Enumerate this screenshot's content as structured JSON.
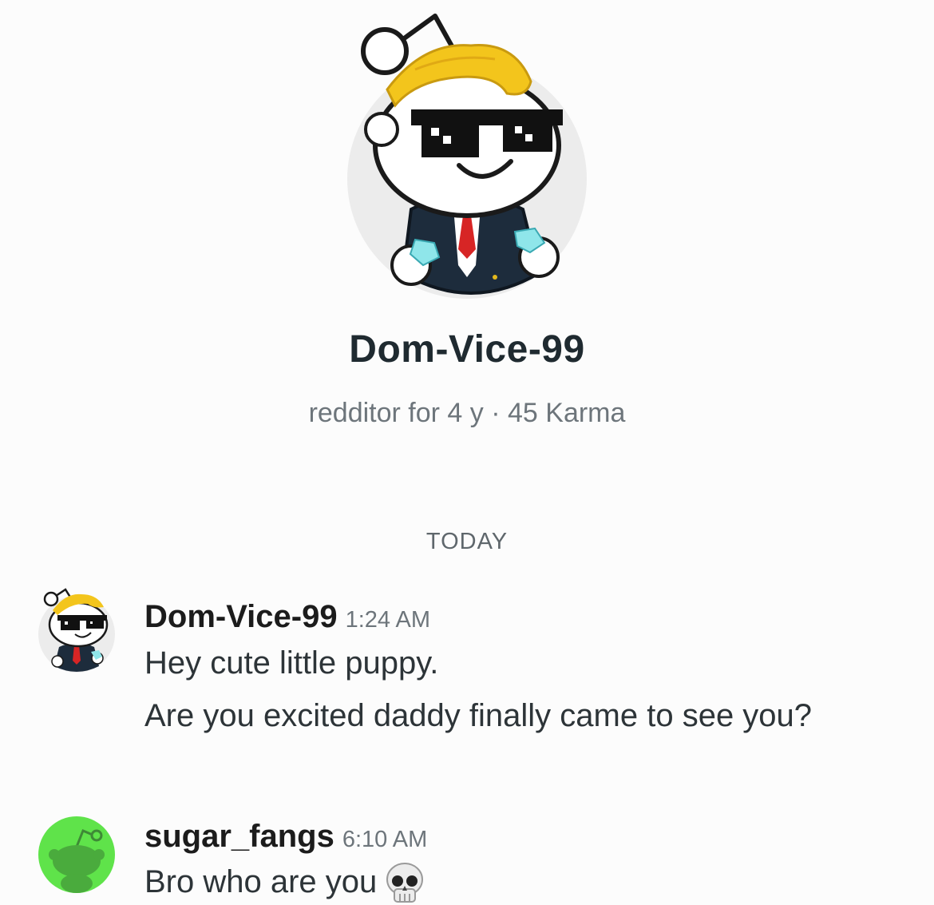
{
  "profile": {
    "username": "Dom-Vice-99",
    "meta": "redditor for 4 y · 45 Karma",
    "avatar_icon": "snoo-avatar-sunglasses-suit"
  },
  "divider": {
    "label": "TODAY"
  },
  "messages": [
    {
      "author": "Dom-Vice-99",
      "time": "1:24 AM",
      "avatar_icon": "snoo-avatar-sunglasses-suit",
      "lines": [
        "Hey cute little puppy.",
        "Are you excited daddy finally came to see you?"
      ]
    },
    {
      "author": "sugar_fangs",
      "time": "6:10 AM",
      "avatar_icon": "default-snoo-avatar-green",
      "lines": [
        "Bro who are you"
      ],
      "emoji_icon": "skull-emoji"
    }
  ],
  "colors": {
    "avatar_green": "#5fe34a",
    "hair_yellow": "#f3c51c",
    "suit_navy": "#1d2c3c",
    "tie_red": "#d72525"
  }
}
